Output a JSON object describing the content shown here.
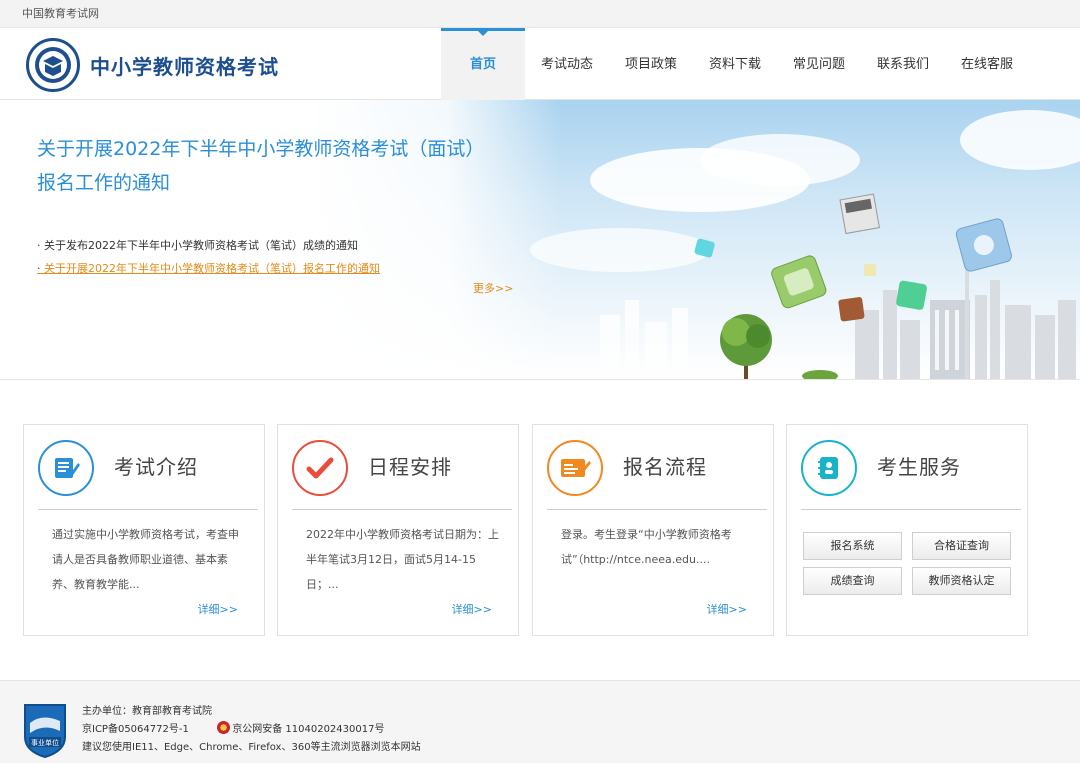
{
  "topbar": {
    "site_name": "中国教育考试网"
  },
  "header": {
    "title": "中小学教师资格考试",
    "nav": [
      {
        "label": "首页",
        "active": true
      },
      {
        "label": "考试动态"
      },
      {
        "label": "项目政策"
      },
      {
        "label": "资料下载"
      },
      {
        "label": "常见问题"
      },
      {
        "label": "联系我们"
      },
      {
        "label": "在线客服"
      }
    ]
  },
  "banner": {
    "headline": "关于开展2022年下半年中小学教师资格考试（面试）报名工作的通知",
    "news": [
      "关于发布2022年下半年中小学教师资格考试（笔试）成绩的通知",
      "关于开展2022年下半年中小学教师资格考试（笔试）报名工作的通知"
    ],
    "more": "更多>>"
  },
  "cards": [
    {
      "title": "考试介绍",
      "icon": "exam-intro-icon",
      "color": "#2a8fd6",
      "body": "通过实施中小学教师资格考试，考查申请人是否具备教师职业道德、基本素养、教育教学能...",
      "detail": "详细>>"
    },
    {
      "title": "日程安排",
      "icon": "checkmark-icon",
      "color": "#e84d3c",
      "body": "2022年中小学教师资格考试日期为：上半年笔试3月12日，面试5月14-15日；...",
      "detail": "详细>>"
    },
    {
      "title": "报名流程",
      "icon": "registration-form-icon",
      "color": "#f0891e",
      "body": "登录。考生登录“中小学教师资格考试”（http://ntce.neea.edu....",
      "detail": "详细>>"
    },
    {
      "title": "考生服务",
      "icon": "service-book-icon",
      "color": "#19b3c9",
      "buttons": [
        "报名系统",
        "合格证查询",
        "成绩查询",
        "教师资格认定"
      ]
    }
  ],
  "footer": {
    "sponsor": "主办单位：教育部教育考试院",
    "icp": "京ICP备05064772号-1",
    "police": "京公网安备 11040202430017号",
    "browser_tip": "建议您使用IE11、Edge、Chrome、Firefox、360等主流浏览器浏览本网站",
    "badge_text": "事业单位"
  }
}
